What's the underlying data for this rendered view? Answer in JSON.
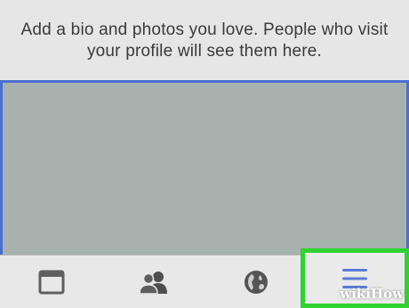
{
  "profile": {
    "intro_text": "Add a bio and photos you love. People who visit your profile will see them here."
  },
  "tabbar": {
    "tabs": [
      {
        "id": "news-feed",
        "icon": "news-feed-icon",
        "active": false
      },
      {
        "id": "friends",
        "icon": "friends-icon",
        "active": false
      },
      {
        "id": "notifications",
        "icon": "globe-icon",
        "active": false
      },
      {
        "id": "menu",
        "icon": "hamburger-menu-icon",
        "active": false,
        "highlighted": true
      }
    ]
  },
  "colors": {
    "photo_border": "#4a6fd1",
    "highlight": "#2fd22f",
    "menu_icon": "#5b7bd5"
  },
  "watermark": "wikiHow"
}
